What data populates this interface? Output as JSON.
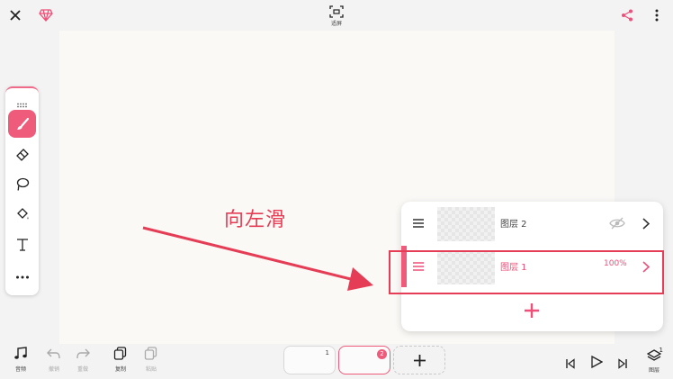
{
  "topbar": {
    "fit_label": "适屏"
  },
  "toolbox": {
    "tools": [
      "brush",
      "eraser",
      "lasso",
      "fill",
      "text",
      "more"
    ]
  },
  "annotation": {
    "text": "向左滑",
    "color": "#e53d55"
  },
  "layers": {
    "items": [
      {
        "name": "图层 2",
        "hidden": true
      },
      {
        "name": "图层 1",
        "opacity": "100%",
        "active": true
      }
    ]
  },
  "bottombar": {
    "music_label": "音频",
    "undo_label": "撤销",
    "redo_label": "重做",
    "copy_label": "复制",
    "paste_label": "粘贴",
    "layers_label": "图层",
    "layers_count": "1"
  },
  "frames": {
    "items": [
      {
        "number": "1",
        "active": false
      },
      {
        "number": "2",
        "active": true
      }
    ]
  },
  "colors": {
    "accent": "#ef5b7a",
    "annotation": "#e53d55"
  }
}
